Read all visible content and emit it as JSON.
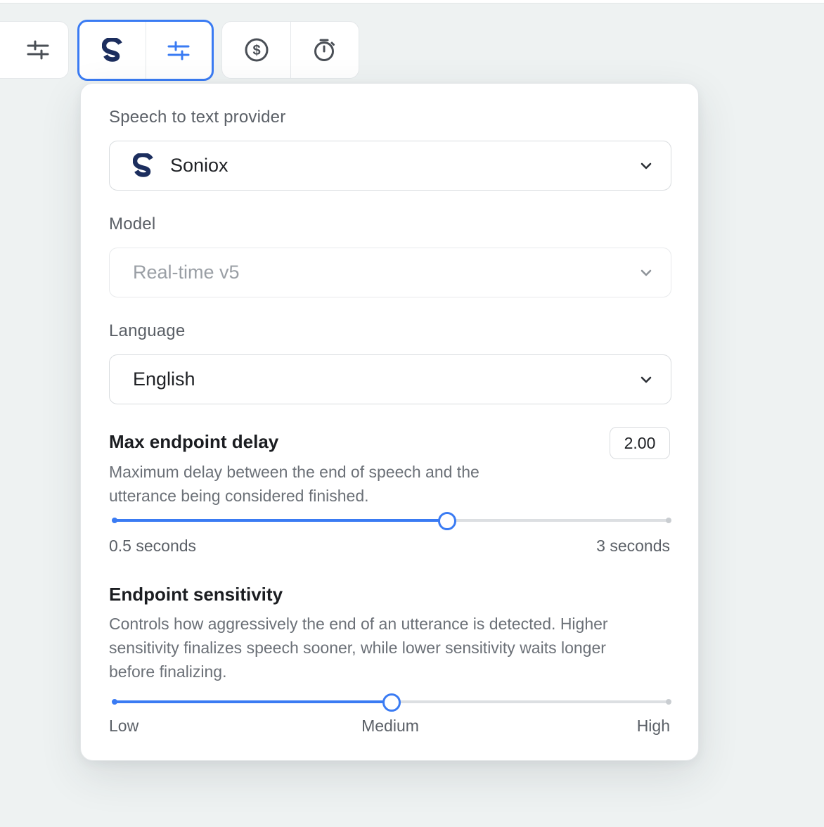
{
  "toolbar": {
    "groups": [
      {
        "items": [
          "settings-sliders-icon"
        ]
      },
      {
        "items": [
          "soniox-logo-icon",
          "settings-sliders-icon"
        ],
        "active": true
      },
      {
        "items": [
          "dollar-circle-icon",
          "stopwatch-icon"
        ]
      }
    ]
  },
  "panel": {
    "provider_label": "Speech to text provider",
    "provider_value": "Soniox",
    "model_label": "Model",
    "model_value": "Real-time v5",
    "language_label": "Language",
    "language_value": "English",
    "endpoint_delay": {
      "title": "Max endpoint delay",
      "value": "2.00",
      "description_line1": "Maximum delay between the end of speech and the",
      "description_line2": "utterance being considered finished.",
      "min_label": "0.5 seconds",
      "max_label": "3 seconds",
      "min": 0.5,
      "max": 3,
      "current": 2.0
    },
    "sensitivity": {
      "title": "Endpoint sensitivity",
      "description_line1": "Controls how aggressively the end of an utterance is detected. Higher",
      "description_line2": "sensitivity finalizes speech sooner, while lower sensitivity waits longer",
      "description_line3": "before finalizing.",
      "low_label": "Low",
      "mid_label": "Medium",
      "high_label": "High",
      "current_fraction": 0.5
    }
  },
  "colors": {
    "accent": "#3a7bf3",
    "brand_navy": "#1c2e5e",
    "icon_gray": "#4a4f56"
  }
}
